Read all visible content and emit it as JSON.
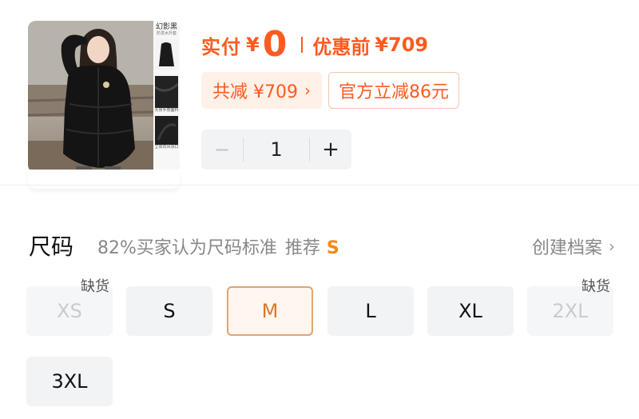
{
  "product": {
    "thumb_brand": "幻影黑",
    "thumb_sub": "防泼水外套",
    "thumb_caption_1": "大身手感面料",
    "thumb_caption_2": "立体防风领口"
  },
  "price": {
    "paid_label": "实付",
    "currency": "¥",
    "paid_value": "0",
    "original_label": "优惠前",
    "original_value": "¥709"
  },
  "discounts": {
    "total_label": "共减 ¥709",
    "total_chevron": "›",
    "official_label": "官方立减86元"
  },
  "quantity": {
    "minus": "−",
    "value": "1",
    "plus": "+"
  },
  "size": {
    "title": "尺码",
    "hint": "82%买家认为尺码标准",
    "recommend_label": "推荐",
    "recommend_value": "S",
    "create_profile": "创建档案",
    "chevron": "›",
    "out_of_stock_label": "缺货",
    "options": [
      {
        "label": "XS",
        "state": "out_of_stock"
      },
      {
        "label": "S",
        "state": "available"
      },
      {
        "label": "M",
        "state": "selected"
      },
      {
        "label": "L",
        "state": "available"
      },
      {
        "label": "XL",
        "state": "available"
      },
      {
        "label": "2XL",
        "state": "out_of_stock"
      },
      {
        "label": "3XL",
        "state": "available"
      }
    ]
  },
  "colors": {
    "accent": "#ff5a1f",
    "selected_border": "#e0a470",
    "chip_bg": "#f2f3f5"
  }
}
